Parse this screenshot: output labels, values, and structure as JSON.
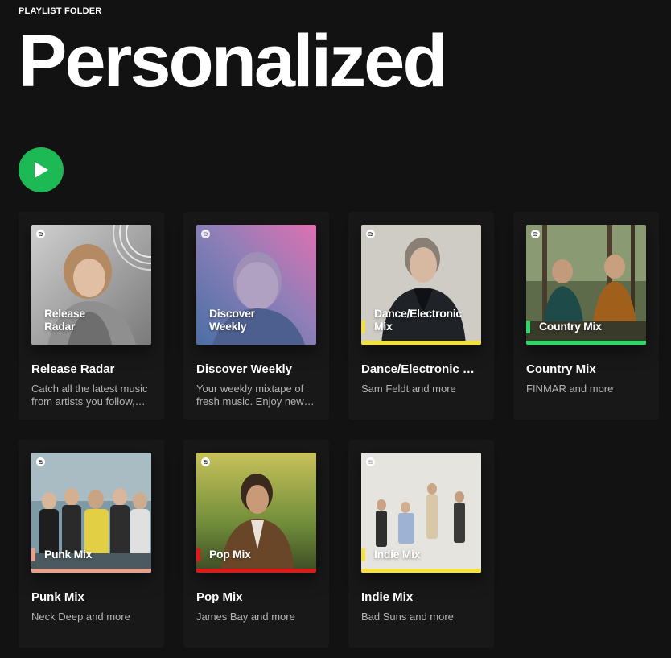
{
  "header": {
    "folder_label": "PLAYLIST FOLDER",
    "title": "Personalized"
  },
  "play_button": {
    "icon": "play-icon",
    "color": "#1db954"
  },
  "cards": [
    {
      "title": "Release Radar",
      "description": "Catch all the latest music from artists you follow, plus new singles picked for you.",
      "cover_text": "Release\nRadar",
      "accent": ""
    },
    {
      "title": "Discover Weekly",
      "description": "Your weekly mixtape of fresh music. Enjoy new music and deep cuts picked for you.",
      "cover_text": "Discover\nWeekly",
      "accent": ""
    },
    {
      "title": "Dance/Electronic Mix",
      "description": "Sam Feldt and more",
      "cover_text": "Dance/Electronic\nMix",
      "accent": "#f0e040"
    },
    {
      "title": "Country Mix",
      "description": "FINMAR and more",
      "cover_text": "Country Mix",
      "accent": "#2fd566"
    },
    {
      "title": "Punk Mix",
      "description": "Neck Deep and more",
      "cover_text": "Punk Mix",
      "accent": "#e8a08c"
    },
    {
      "title": "Pop Mix",
      "description": "James Bay and more",
      "cover_text": "Pop Mix",
      "accent": "#e01818"
    },
    {
      "title": "Indie Mix",
      "description": "Bad Suns and more",
      "cover_text": "Indie Mix",
      "accent": "#f5e23a"
    }
  ],
  "colors": {
    "background": "#121212",
    "card": "#181818",
    "secondary_text": "#b3b3b3",
    "spotify_green": "#1db954"
  }
}
